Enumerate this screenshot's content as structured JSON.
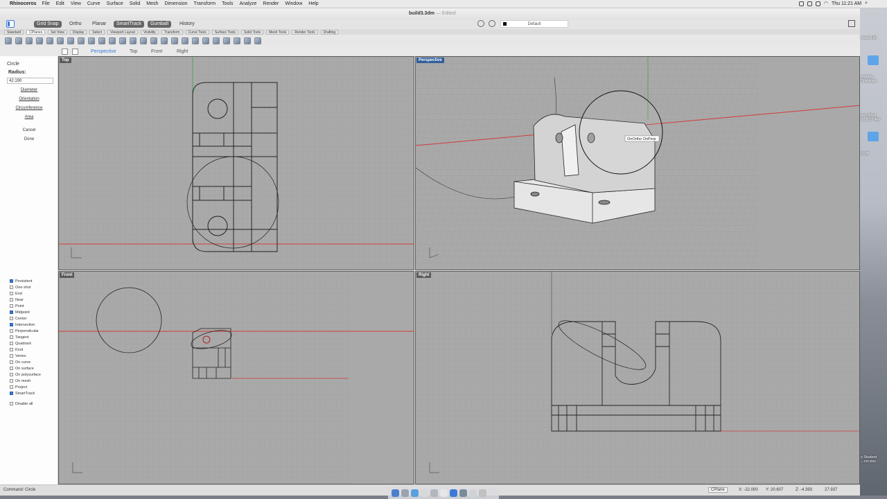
{
  "menubar": {
    "app": "Rhinoceros",
    "items": [
      "File",
      "Edit",
      "View",
      "Curve",
      "Surface",
      "Solid",
      "Mesh",
      "Dimension",
      "Transform",
      "Tools",
      "Analyze",
      "Render",
      "Window",
      "Help"
    ],
    "clock": "Thu 11:21 AM"
  },
  "window": {
    "title": "build3.3dm",
    "title_suffix": "— Edited"
  },
  "toolbar": {
    "modes": [
      {
        "label": "Grid Snap",
        "on": true
      },
      {
        "label": "Ortho",
        "on": false
      },
      {
        "label": "Planar",
        "on": false
      },
      {
        "label": "SmartTrack",
        "on": true
      },
      {
        "label": "Gumball",
        "on": true
      },
      {
        "label": "History",
        "on": false
      }
    ],
    "display_mode": "Default"
  },
  "tabs": [
    "Standard",
    "CPlanes",
    "Set View",
    "Display",
    "Select",
    "Viewport Layout",
    "Visibility",
    "Transform",
    "Curve Tools",
    "Surface Tools",
    "Solid Tools",
    "Mesh Tools",
    "Render Tools",
    "Drafting"
  ],
  "selected_tab": "CPlanes",
  "viewport_tabs": [
    "Perspective",
    "Top",
    "Front",
    "Right"
  ],
  "command": {
    "title": "Circle",
    "radius_label": "Radius:",
    "radius_value": "42.190",
    "options": [
      "Diameter",
      "Orientation",
      "Circumference",
      "Area",
      "Cancel",
      "Done"
    ]
  },
  "osnap": [
    {
      "label": "Persistent",
      "on": true
    },
    {
      "label": "One shot",
      "on": false
    },
    {
      "label": "End",
      "on": false
    },
    {
      "label": "Near",
      "on": false
    },
    {
      "label": "Point",
      "on": false
    },
    {
      "label": "Midpoint",
      "on": true
    },
    {
      "label": "Center",
      "on": false
    },
    {
      "label": "Intersection",
      "on": true
    },
    {
      "label": "Perpendicular",
      "on": false
    },
    {
      "label": "Tangent",
      "on": false
    },
    {
      "label": "Quadrant",
      "on": false
    },
    {
      "label": "Knot",
      "on": false
    },
    {
      "label": "Vertex",
      "on": false
    },
    {
      "label": "On curve",
      "on": false
    },
    {
      "label": "On surface",
      "on": false
    },
    {
      "label": "On polysurface",
      "on": false
    },
    {
      "label": "On mesh",
      "on": false
    },
    {
      "label": "Project",
      "on": false
    },
    {
      "label": "SmartTrack",
      "on": true
    }
  ],
  "disable_all": "Disable all",
  "viewports": {
    "top": "Top",
    "perspective": "Perspective",
    "front": "Front",
    "right": "Right"
  },
  "snap_tooltip": "OnOrtho OnPerp",
  "status": {
    "command": "Command: Circle",
    "cplane": "CPlane",
    "x": "X: -22.000",
    "y": "Y: 20.607",
    "z": "Z: -4.393",
    "dist": "27.937"
  },
  "desktop": {
    "labels": [
      "ntosh HD",
      "ometric Drawings",
      "een Shot 0...8.17 AM",
      "Stuff",
      "v Student ...ort.xlsx"
    ]
  },
  "colors": {
    "viewport_bg": "#a9a9a9",
    "grid": "#9c9c9c",
    "axis_x": "#d23a3a",
    "axis_y": "#3aa84a",
    "active_label": "#2f5d9c"
  }
}
